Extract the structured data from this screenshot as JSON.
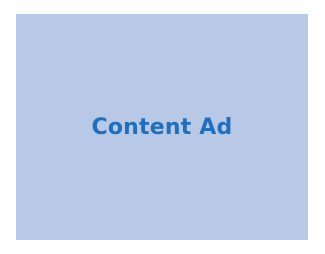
{
  "ad": {
    "label": "Content Ad",
    "background_color": "#b7c9e6",
    "text_color": "#1f6fbe"
  }
}
